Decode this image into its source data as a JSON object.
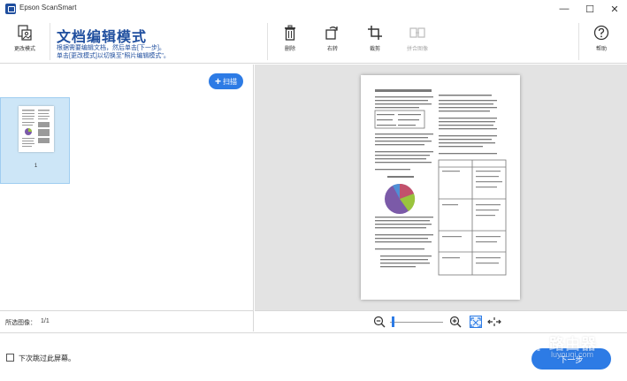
{
  "window": {
    "title": "Epson ScanSmart",
    "minimize_glyph": "—",
    "maximize_glyph": "☐",
    "close_glyph": "✕"
  },
  "toolbar": {
    "change_mode_label": "更改模式",
    "mode_title": "文档编辑模式",
    "mode_desc_line1": "根据需要编辑文档，然后单击[下一步]。",
    "mode_desc_line2": "单击[更改模式]以切换至\"照片编辑模式\"。",
    "delete_label": "删除",
    "rotate_label": "右转",
    "crop_label": "裁剪",
    "merge_label": "拼合图像",
    "help_label": "帮助"
  },
  "left_pane": {
    "scan_button_label": "扫描",
    "thumbnails": [
      {
        "number": "1",
        "selected": true
      }
    ],
    "selected_label": "所选图像：",
    "selected_value": "1/1"
  },
  "zoom": {
    "zoom_level_fraction": 0.05
  },
  "bottom": {
    "skip_checkbox_label": "下次跳过此屏幕。",
    "skip_checked": false,
    "next_button_label": "下一步"
  },
  "watermark": {
    "text": "路由器",
    "subtext": "luyouqi.com"
  },
  "colors": {
    "accent": "#2d7be5",
    "brand": "#1f4e9e",
    "thumb_selected": "#cde6f7",
    "preview_bg": "#e3e3e3"
  },
  "icons": {
    "app": "epson-scansmart-icon",
    "change_mode": "change-mode-icon",
    "delete": "trash-icon",
    "rotate": "rotate-right-icon",
    "crop": "crop-icon",
    "merge": "merge-images-icon",
    "help": "help-icon",
    "zoom_out": "zoom-out-icon",
    "zoom_in": "zoom-in-icon",
    "fit": "fit-to-window-icon",
    "expand": "expand-icon"
  }
}
